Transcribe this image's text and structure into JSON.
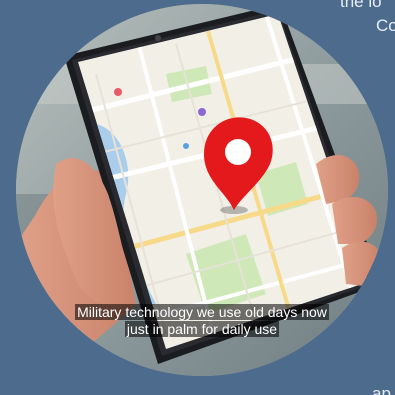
{
  "background_text": {
    "line1": "the lo",
    "line2": "Co",
    "line3": "ap"
  },
  "image": {
    "subject": "hand-holding-smartphone-with-map",
    "pin_color": "#e3191c",
    "caption_line1": "Military technology we use old days now",
    "caption_line2": "just in palm for daily use"
  }
}
